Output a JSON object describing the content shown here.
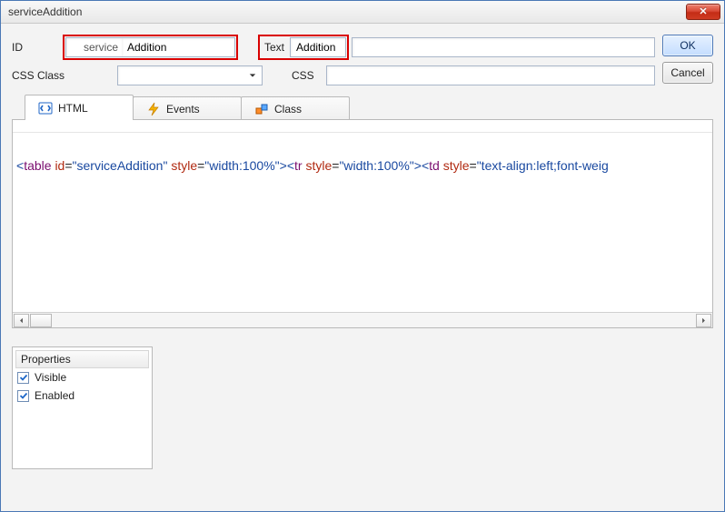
{
  "title": "serviceAddition",
  "buttons": {
    "ok": "OK",
    "cancel": "Cancel"
  },
  "fields": {
    "id_label": "ID",
    "id_prefix": "service",
    "id_value": "Addition",
    "text_label": "Text",
    "text_value": "Addition",
    "css_class_label": "CSS Class",
    "css_class_value": "",
    "css_label": "CSS",
    "css_value": ""
  },
  "tabs": {
    "html": "HTML",
    "events": "Events",
    "class": "Class"
  },
  "code": {
    "tokens": [
      {
        "c": "t-punc",
        "t": "<"
      },
      {
        "c": "t-tag",
        "t": "table"
      },
      {
        "c": "",
        "t": " "
      },
      {
        "c": "t-attr",
        "t": "id"
      },
      {
        "c": "t-eq",
        "t": "="
      },
      {
        "c": "t-str",
        "t": "\"serviceAddition\""
      },
      {
        "c": "",
        "t": " "
      },
      {
        "c": "t-attr",
        "t": "style"
      },
      {
        "c": "t-eq",
        "t": "="
      },
      {
        "c": "t-str",
        "t": "\"width:100%\""
      },
      {
        "c": "t-punc",
        "t": ">"
      },
      {
        "c": "t-punc",
        "t": "<"
      },
      {
        "c": "t-tag",
        "t": "tr"
      },
      {
        "c": "",
        "t": " "
      },
      {
        "c": "t-attr",
        "t": "style"
      },
      {
        "c": "t-eq",
        "t": "="
      },
      {
        "c": "t-str",
        "t": "\"width:100%\""
      },
      {
        "c": "t-punc",
        "t": ">"
      },
      {
        "c": "t-punc",
        "t": "<"
      },
      {
        "c": "t-tag",
        "t": "td"
      },
      {
        "c": "",
        "t": " "
      },
      {
        "c": "t-attr",
        "t": "style"
      },
      {
        "c": "t-eq",
        "t": "="
      },
      {
        "c": "t-str",
        "t": "\"text-align:left;font-weig"
      }
    ]
  },
  "properties": {
    "header": "Properties",
    "items": [
      {
        "label": "Visible",
        "checked": true
      },
      {
        "label": "Enabled",
        "checked": true
      }
    ]
  }
}
